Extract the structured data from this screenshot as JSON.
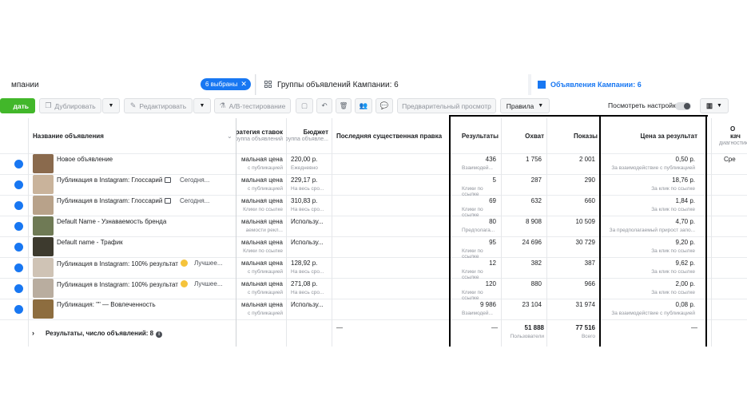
{
  "tabs": {
    "campaigns": "мпании",
    "selected_chip": "6 выбраны",
    "adsets": "Группы объявлений Кампании: 6",
    "ads": "Объявления Кампании: 6"
  },
  "toolbar": {
    "create": "дать",
    "duplicate": "Дублировать",
    "edit": "Редактировать",
    "ab_test": "A/B-тестирование",
    "preview": "Предварительный просмотр",
    "rules": "Правила",
    "view_settings": "Посмотреть настройки"
  },
  "columns": {
    "name": "Название объявления",
    "bid": "ратегия ставок",
    "bid_sub": "Группа объявлений",
    "budget": "Бюджет",
    "budget_sub": "Группа объявле...",
    "last_edit": "Последняя существенная правка",
    "results": "Результаты",
    "reach": "Охват",
    "impressions": "Показы",
    "cpr": "Цена за результат",
    "quality": "О",
    "quality2": "кач",
    "quality_sub": "диагностик"
  },
  "rows": [
    {
      "name": "Новое объявление",
      "extra": "",
      "bid": "мальная цена",
      "bid_sub": "с публикацией",
      "budget": "220,00 р.",
      "budget_sub": "Ежедневно",
      "results": "436",
      "results_sub": "Взаимодей...",
      "reach": "1 756",
      "impressions": "2 001",
      "cpr": "0,50 р.",
      "cpr_sub": "За взаимодействие с публикацией",
      "quality": "Сре",
      "thumb": "#8a6a4d"
    },
    {
      "name": "Публикация в Instagram: Глоссарий",
      "extra": "Сегодня...",
      "icon": "sq",
      "bid": "мальная цена",
      "bid_sub": "с публикацией",
      "budget": "229,17 р.",
      "budget_sub": "На весь сро...",
      "results": "5",
      "results_sub": "Клики по ссылке",
      "reach": "287",
      "impressions": "290",
      "cpr": "18,76 р.",
      "cpr_sub": "За клик по ссылке",
      "quality": "",
      "thumb": "#c9b39b"
    },
    {
      "name": "Публикация в Instagram: Глоссарий",
      "extra": "Сегодня...",
      "icon": "sq",
      "bid": "мальная цена",
      "bid_sub": "Клики по ссылке",
      "budget": "310,83 р.",
      "budget_sub": "На весь сро...",
      "results": "69",
      "results_sub": "Клики по ссылке",
      "reach": "632",
      "impressions": "660",
      "cpr": "1,84 р.",
      "cpr_sub": "За клик по ссылке",
      "quality": "",
      "thumb": "#b8a28a"
    },
    {
      "name": "Default Name - Узнаваемость бренда",
      "extra": "",
      "bid": "мальная цена",
      "bid_sub": "аемости рекл...",
      "budget": "Использу...",
      "budget_sub": "",
      "results": "80",
      "results_sub": "Предполага...",
      "reach": "8 908",
      "impressions": "10 509",
      "cpr": "4,70 р.",
      "cpr_sub": "За предполагаемый прирост запо...",
      "quality": "",
      "thumb": "#6f7a55"
    },
    {
      "name": "Default name - Трафик",
      "extra": "",
      "bid": "мальная цена",
      "bid_sub": "Клики по ссылке",
      "budget": "Использу...",
      "budget_sub": "",
      "results": "95",
      "results_sub": "Клики по ссылке",
      "reach": "24 696",
      "impressions": "30 729",
      "cpr": "9,20 р.",
      "cpr_sub": "За клик по ссылке",
      "quality": "",
      "thumb": "#3d3a2e"
    },
    {
      "name": "Публикация в Instagram: 100% результат",
      "extra": "Лучшее...",
      "icon": "face",
      "bid": "мальная цена",
      "bid_sub": "с публикацией",
      "budget": "128,92 р.",
      "budget_sub": "На весь сро...",
      "results": "12",
      "results_sub": "Клики по ссылке",
      "reach": "382",
      "impressions": "387",
      "cpr": "9,62 р.",
      "cpr_sub": "За клик по ссылке",
      "quality": "",
      "thumb": "#cfc3b5"
    },
    {
      "name": "Публикация в Instagram: 100% результат",
      "extra": "Лучшее...",
      "icon": "face",
      "bid": "мальная цена",
      "bid_sub": "с публикацией",
      "budget": "271,08 р.",
      "budget_sub": "На весь сро...",
      "results": "120",
      "results_sub": "Клики по ссылке",
      "reach": "880",
      "impressions": "966",
      "cpr": "2,00 р.",
      "cpr_sub": "За клик по ссылке",
      "quality": "",
      "thumb": "#b9ad9f"
    },
    {
      "name": "Публикация: \"\" — Вовлеченность",
      "extra": "",
      "bid": "мальная цена",
      "bid_sub": "с публикацией",
      "budget": "Использу...",
      "budget_sub": "",
      "results": "9 986",
      "results_sub": "Взаимодей...",
      "reach": "23 104",
      "impressions": "31 974",
      "cpr": "0,08 р.",
      "cpr_sub": "За взаимодействие с публикацией",
      "quality": "",
      "thumb": "#8d6d3f"
    }
  ],
  "totals": {
    "label": "Результаты, число объявлений: 8",
    "last_edit": "—",
    "results": "—",
    "reach": "51 888",
    "reach_sub": "Пользователи",
    "impressions": "77 516",
    "impressions_sub": "Всего",
    "cpr": "—"
  },
  "colors": {
    "accent": "#1877f2",
    "create": "#42b72a"
  }
}
